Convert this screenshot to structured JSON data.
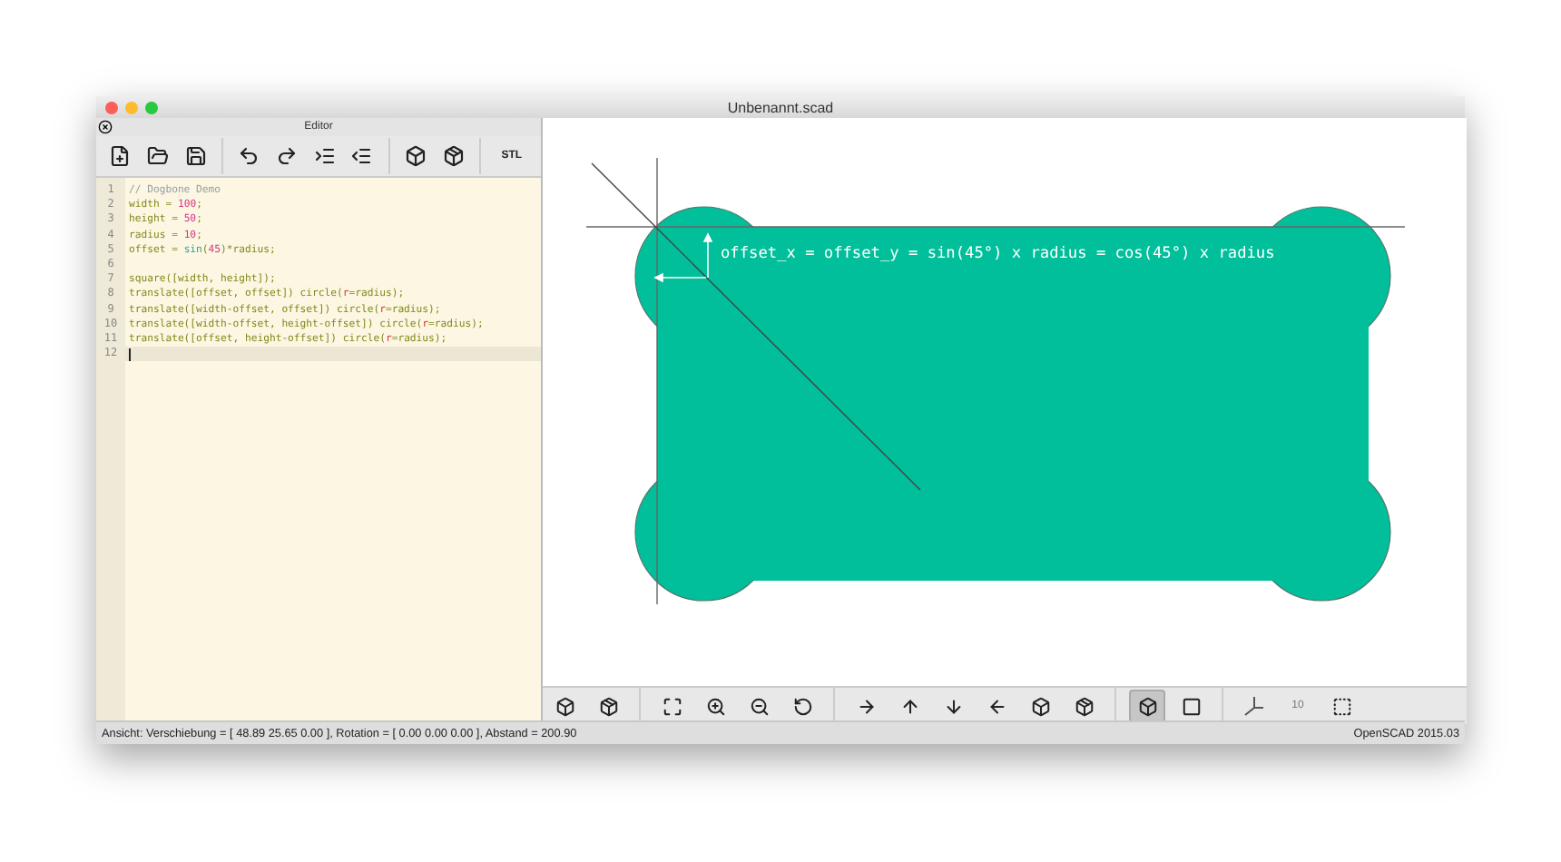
{
  "window": {
    "title": "Unbenannt.scad"
  },
  "editor": {
    "title": "Editor",
    "toolbar": [
      {
        "kind": "new"
      },
      {
        "kind": "open"
      },
      {
        "kind": "save"
      },
      {
        "kind": "sep"
      },
      {
        "kind": "undo"
      },
      {
        "kind": "redo"
      },
      {
        "kind": "indent"
      },
      {
        "kind": "unindent"
      },
      {
        "kind": "sep"
      },
      {
        "kind": "preview"
      },
      {
        "kind": "render"
      },
      {
        "kind": "sep"
      },
      {
        "kind": "stl",
        "label": "STL"
      }
    ],
    "lines": [
      {
        "number": "1",
        "tokens": [
          {
            "kind": "comment",
            "text": "// Dogbone Demo"
          }
        ]
      },
      {
        "number": "2",
        "tokens": [
          {
            "kind": "text",
            "text": "width = "
          },
          {
            "kind": "number",
            "text": "100"
          },
          {
            "kind": "text",
            "text": ";"
          }
        ]
      },
      {
        "number": "3",
        "tokens": [
          {
            "kind": "text",
            "text": "height = "
          },
          {
            "kind": "number",
            "text": "50"
          },
          {
            "kind": "text",
            "text": ";"
          }
        ]
      },
      {
        "number": "4",
        "tokens": [
          {
            "kind": "text",
            "text": "radius = "
          },
          {
            "kind": "number",
            "text": "10"
          },
          {
            "kind": "text",
            "text": ";"
          }
        ]
      },
      {
        "number": "5",
        "tokens": [
          {
            "kind": "text",
            "text": "offset = "
          },
          {
            "kind": "builtin",
            "text": "sin"
          },
          {
            "kind": "text",
            "text": "("
          },
          {
            "kind": "number",
            "text": "45"
          },
          {
            "kind": "text",
            "text": ")*radius;"
          }
        ]
      },
      {
        "number": "6"
      },
      {
        "number": "7",
        "tokens": [
          {
            "kind": "text",
            "text": "square([width, height]);"
          }
        ]
      },
      {
        "number": "8",
        "tokens": [
          {
            "kind": "text",
            "text": "translate([offset, offset]) circle("
          },
          {
            "kind": "param",
            "text": "r"
          },
          {
            "kind": "text",
            "text": "=radius);"
          }
        ]
      },
      {
        "number": "9",
        "tokens": [
          {
            "kind": "text",
            "text": "translate([width-offset, offset]) circle("
          },
          {
            "kind": "param",
            "text": "r"
          },
          {
            "kind": "text",
            "text": "=radius);"
          }
        ]
      },
      {
        "number": "10",
        "tokens": [
          {
            "kind": "text",
            "text": "translate([width-offset, height-offset]) circle("
          },
          {
            "kind": "param",
            "text": "r"
          },
          {
            "kind": "text",
            "text": "=radius);"
          }
        ]
      },
      {
        "number": "11",
        "tokens": [
          {
            "kind": "text",
            "text": "translate([offset, height-offset]) circle("
          },
          {
            "kind": "param",
            "text": "r"
          },
          {
            "kind": "text",
            "text": "=radius);"
          }
        ]
      },
      {
        "number": "12",
        "current": true
      }
    ]
  },
  "viewer": {
    "annotation": "offset_x = offset_y = sin(45°) x radius = cos(45°) x radius",
    "toolbar": [
      {
        "kind": "preview",
        "selected": false
      },
      {
        "kind": "render",
        "selected": false
      },
      {
        "kind": "sep"
      },
      {
        "kind": "zoom-all",
        "selected": false
      },
      {
        "kind": "zoom-in",
        "selected": false
      },
      {
        "kind": "zoom-out",
        "selected": false
      },
      {
        "kind": "reset",
        "selected": false
      },
      {
        "kind": "sep"
      },
      {
        "kind": "right",
        "selected": false
      },
      {
        "kind": "top",
        "selected": false
      },
      {
        "kind": "bottom",
        "selected": false
      },
      {
        "kind": "left",
        "selected": false
      },
      {
        "kind": "front",
        "selected": false
      },
      {
        "kind": "back",
        "selected": false
      },
      {
        "kind": "sep"
      },
      {
        "kind": "perspective",
        "selected": true
      },
      {
        "kind": "orthogonal",
        "selected": false
      },
      {
        "kind": "sep"
      },
      {
        "kind": "axes",
        "selected": false
      },
      {
        "kind": "scale",
        "selected": false,
        "label": "10"
      },
      {
        "kind": "edges",
        "selected": false
      }
    ]
  },
  "status_bar": {
    "left": "Ansicht: Verschiebung = [ 48.89 25.65 0.00 ], Rotation = [ 0.00 0.00 0.00 ], Abstand = 200.90",
    "right": "OpenSCAD 2015.03"
  }
}
